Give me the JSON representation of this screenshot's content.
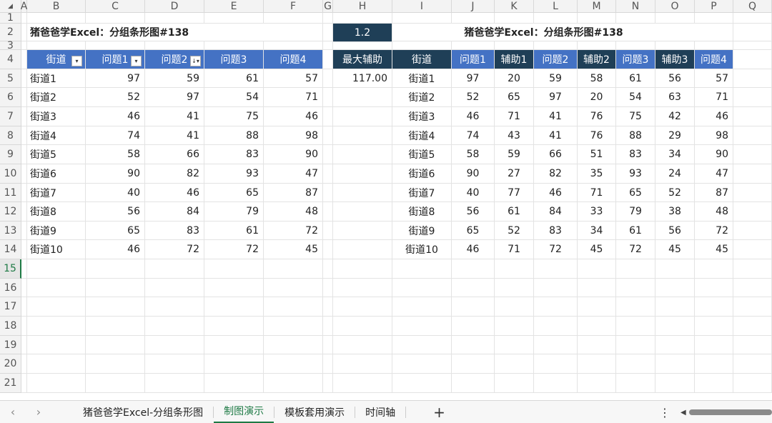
{
  "columns": [
    "A",
    "B",
    "C",
    "D",
    "E",
    "F",
    "G",
    "H",
    "I",
    "J",
    "K",
    "L",
    "M",
    "N",
    "O",
    "P",
    "Q"
  ],
  "rows": [
    "1",
    "2",
    "3",
    "4",
    "5",
    "6",
    "7",
    "8",
    "9",
    "10",
    "11",
    "12",
    "13",
    "14",
    "15",
    "16",
    "17",
    "18",
    "19",
    "20",
    "21"
  ],
  "active_row": "15",
  "left_table": {
    "title": "猪爸爸学Excel：分组条形图#138",
    "headers": [
      "街道",
      "问题1",
      "问题2",
      "问题3",
      "问题4"
    ],
    "rows": [
      [
        "街道1",
        "97",
        "59",
        "61",
        "57"
      ],
      [
        "街道2",
        "52",
        "97",
        "54",
        "71"
      ],
      [
        "街道3",
        "46",
        "41",
        "75",
        "46"
      ],
      [
        "街道4",
        "74",
        "41",
        "88",
        "98"
      ],
      [
        "街道5",
        "58",
        "66",
        "83",
        "90"
      ],
      [
        "街道6",
        "90",
        "82",
        "93",
        "47"
      ],
      [
        "街道7",
        "40",
        "46",
        "65",
        "87"
      ],
      [
        "街道8",
        "56",
        "84",
        "79",
        "48"
      ],
      [
        "街道9",
        "65",
        "83",
        "61",
        "72"
      ],
      [
        "街道10",
        "46",
        "72",
        "72",
        "45"
      ]
    ]
  },
  "right_table": {
    "param_value": "1.2",
    "title": "猪爸爸学Excel：分组条形图#138",
    "headers": [
      "最大辅助",
      "街道",
      "问题1",
      "辅助1",
      "问题2",
      "辅助2",
      "问题3",
      "辅助3",
      "问题4"
    ],
    "max_aux_value": "117.00",
    "rows": [
      [
        "街道1",
        "97",
        "20",
        "59",
        "58",
        "61",
        "56",
        "57"
      ],
      [
        "街道2",
        "52",
        "65",
        "97",
        "20",
        "54",
        "63",
        "71"
      ],
      [
        "街道3",
        "46",
        "71",
        "41",
        "76",
        "75",
        "42",
        "46"
      ],
      [
        "街道4",
        "74",
        "43",
        "41",
        "76",
        "88",
        "29",
        "98"
      ],
      [
        "街道5",
        "58",
        "59",
        "66",
        "51",
        "83",
        "34",
        "90"
      ],
      [
        "街道6",
        "90",
        "27",
        "82",
        "35",
        "93",
        "24",
        "47"
      ],
      [
        "街道7",
        "40",
        "77",
        "46",
        "71",
        "65",
        "52",
        "87"
      ],
      [
        "街道8",
        "56",
        "61",
        "84",
        "33",
        "79",
        "38",
        "48"
      ],
      [
        "街道9",
        "65",
        "52",
        "83",
        "34",
        "61",
        "56",
        "72"
      ],
      [
        "街道10",
        "46",
        "71",
        "72",
        "45",
        "72",
        "45",
        "45"
      ]
    ]
  },
  "sheet_tabs": [
    "猪爸爸学Excel-分组条形图",
    "制图演示",
    "模板套用演示",
    "时间轴"
  ],
  "active_tab_index": 1,
  "colors": {
    "header_blue": "#4472c4",
    "header_dark": "#1f3f57",
    "active_green": "#1e7a45"
  },
  "icons": {
    "prev": "chevron-left-icon",
    "next": "chevron-right-icon",
    "add": "plus-icon",
    "more": "more-vertical-icon"
  }
}
